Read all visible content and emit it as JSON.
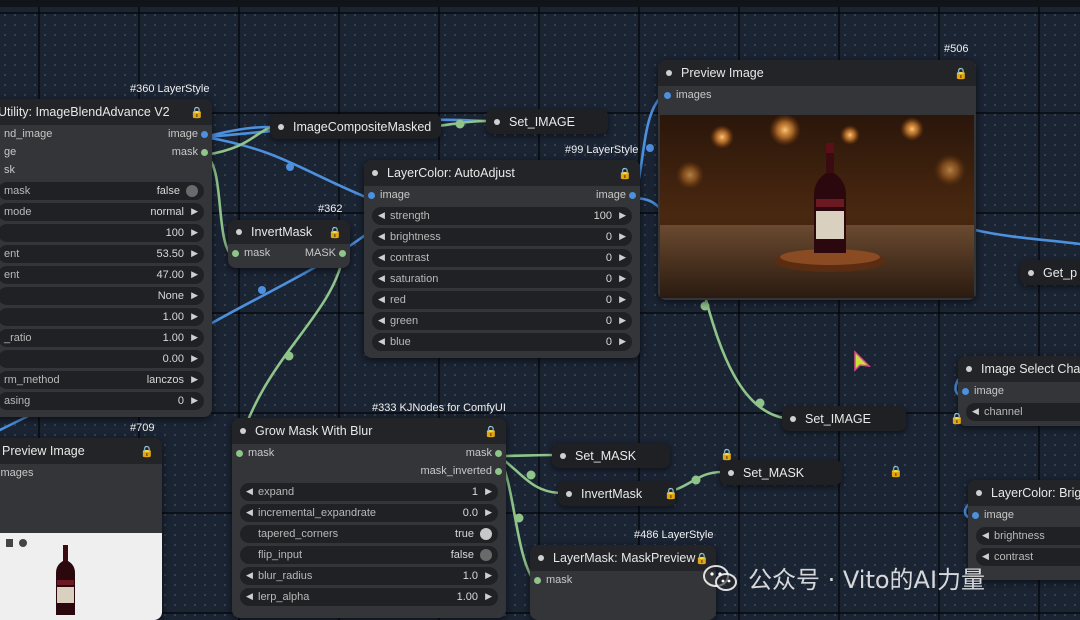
{
  "nodes": {
    "blend": {
      "id": "#360 LayerStyle",
      "title": "Utility: ImageBlendAdvance V2",
      "inputs": [
        "nd_image",
        "ge",
        "sk"
      ],
      "outputs": [
        "image",
        "mask"
      ],
      "widgets": [
        {
          "label": "mask",
          "value": "false",
          "toggle": true
        },
        {
          "label": "mode",
          "value": "normal"
        },
        {
          "label": "",
          "value": "100"
        },
        {
          "label": "ent",
          "value": "53.50"
        },
        {
          "label": "ent",
          "value": "47.00"
        },
        {
          "label": "",
          "value": "None"
        },
        {
          "label": "",
          "value": "1.00"
        },
        {
          "label": "_ratio",
          "value": "1.00"
        },
        {
          "label": "",
          "value": "0.00"
        },
        {
          "label": "rm_method",
          "value": "lanczos"
        },
        {
          "label": "asing",
          "value": "0"
        }
      ]
    },
    "composite": {
      "title": "ImageCompositeMasked"
    },
    "set_image_top": {
      "title": "Set_IMAGE"
    },
    "preview_main": {
      "id": "#506",
      "title": "Preview Image",
      "input": "images"
    },
    "autoadjust": {
      "id": "#99 LayerStyle",
      "title": "LayerColor: AutoAdjust",
      "input": "image",
      "output": "image",
      "widgets": [
        {
          "label": "strength",
          "value": "100"
        },
        {
          "label": "brightness",
          "value": "0"
        },
        {
          "label": "contrast",
          "value": "0"
        },
        {
          "label": "saturation",
          "value": "0"
        },
        {
          "label": "red",
          "value": "0"
        },
        {
          "label": "green",
          "value": "0"
        },
        {
          "label": "blue",
          "value": "0"
        }
      ]
    },
    "invertmask_top": {
      "id": "#362",
      "title": "InvertMask",
      "input": "mask",
      "output": "MASK"
    },
    "growmask": {
      "id": "#333 KJNodes for ComfyUI",
      "title": "Grow Mask With Blur",
      "input": "mask",
      "outputs": [
        "mask",
        "mask_inverted"
      ],
      "widgets": [
        {
          "label": "expand",
          "value": "1",
          "type": "num"
        },
        {
          "label": "incremental_expandrate",
          "value": "0.0",
          "type": "num"
        },
        {
          "label": "tapered_corners",
          "value": "true",
          "type": "toggle",
          "on": true
        },
        {
          "label": "flip_input",
          "value": "false",
          "type": "toggle",
          "on": false
        },
        {
          "label": "blur_radius",
          "value": "1.0",
          "type": "num"
        },
        {
          "label": "lerp_alpha",
          "value": "1.00",
          "type": "num"
        }
      ]
    },
    "preview_small": {
      "id": "#709",
      "title": "Preview Image",
      "input": "images"
    },
    "set_mask_1": {
      "title": "Set_MASK"
    },
    "set_mask_2": {
      "title": "Set_MASK"
    },
    "invertmask_chip": {
      "title": "InvertMask"
    },
    "maskpreview": {
      "id": "#486 LayerStyle",
      "title": "LayerMask: MaskPreview",
      "input": "mask"
    },
    "set_image_mid": {
      "title": "Set_IMAGE"
    },
    "get_p": {
      "title": "Get_p"
    },
    "select_channel": {
      "title": "Image Select Cha",
      "input": "image",
      "widget": "channel"
    },
    "layercolor_bri": {
      "title": "LayerColor: Brig",
      "input": "image",
      "widgets": [
        "brightness",
        "contrast"
      ]
    }
  },
  "watermark": {
    "text": "公众号 · Vito的AI力量",
    "icon": "wechat-icon"
  },
  "colors": {
    "wire_blue": "#4c90de",
    "wire_green": "#8fc48a",
    "lock": "#e0b63c",
    "node_body": "#333538",
    "node_header": "#232427"
  }
}
